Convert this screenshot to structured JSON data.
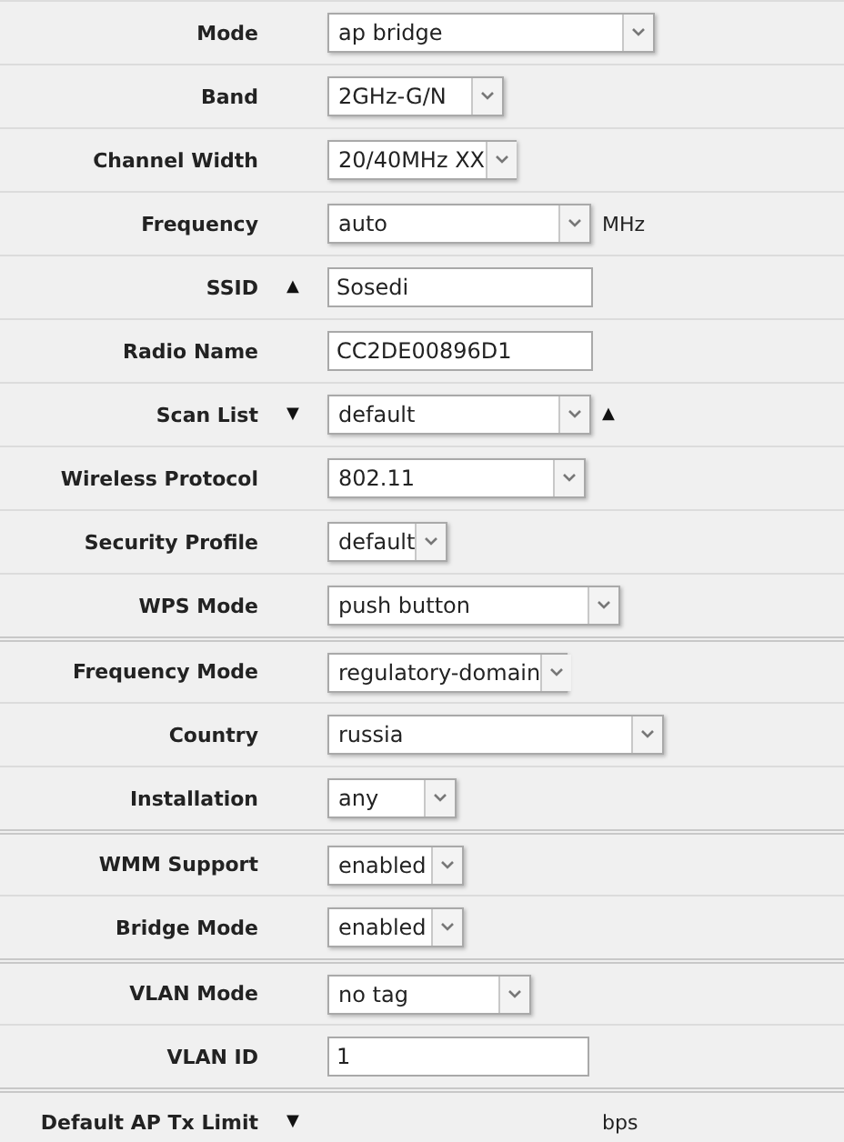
{
  "rows": [
    {
      "label": "Mode",
      "kind": "select",
      "value": "ap bridge",
      "section_start": false
    },
    {
      "label": "Band",
      "kind": "select",
      "value": "2GHz-G/N",
      "section_start": false
    },
    {
      "label": "Channel Width",
      "kind": "select",
      "value": "20/40MHz XX",
      "section_start": false
    },
    {
      "label": "Frequency",
      "kind": "select",
      "value": "auto",
      "unit": "MHz",
      "section_start": false
    },
    {
      "label": "SSID",
      "kind": "text",
      "value": "Sosedi",
      "before_arrow": "▲",
      "section_start": false
    },
    {
      "label": "Radio Name",
      "kind": "text",
      "value": "CC2DE00896D1",
      "section_start": false
    },
    {
      "label": "Scan List",
      "kind": "select",
      "value": "default",
      "before_arrow": "▼",
      "after_arrow": "▲",
      "section_start": false
    },
    {
      "label": "Wireless Protocol",
      "kind": "select",
      "value": "802.11",
      "section_start": false
    },
    {
      "label": "Security Profile",
      "kind": "select",
      "value": "default",
      "section_start": false
    },
    {
      "label": "WPS Mode",
      "kind": "select",
      "value": "push button",
      "section_start": false
    },
    {
      "label": "Frequency Mode",
      "kind": "select",
      "value": "regulatory-domain",
      "section_start": true
    },
    {
      "label": "Country",
      "kind": "select",
      "value": "russia",
      "section_start": false
    },
    {
      "label": "Installation",
      "kind": "select",
      "value": "any",
      "section_start": false
    },
    {
      "label": "WMM Support",
      "kind": "select",
      "value": "enabled",
      "section_start": true
    },
    {
      "label": "Bridge Mode",
      "kind": "select",
      "value": "enabled",
      "section_start": false
    },
    {
      "label": "VLAN Mode",
      "kind": "select",
      "value": "no tag",
      "section_start": true
    },
    {
      "label": "VLAN ID",
      "kind": "text",
      "value": "1",
      "section_start": false
    },
    {
      "label": "Default AP Tx Limit",
      "kind": "none",
      "before_arrow": "▼",
      "unit": "bps",
      "section_start": true
    }
  ]
}
